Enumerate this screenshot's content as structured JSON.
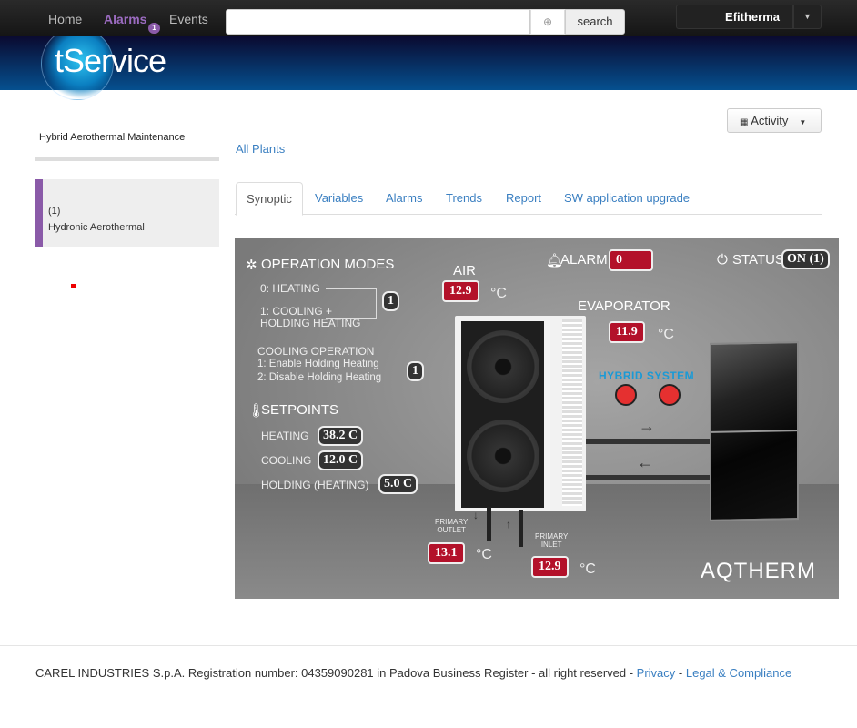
{
  "topnav": {
    "home": "Home",
    "alarms": "Alarms",
    "alarms_badge": "1",
    "events": "Events",
    "search_value": "",
    "search_button": "search",
    "user": "Efitherma"
  },
  "brand": {
    "logo": "tService"
  },
  "sidebar": {
    "plant_name": "Hybrid Aerothermal Maintenance",
    "items": [
      {
        "id": "(1)",
        "label": "Hydronic Aerothermal"
      }
    ]
  },
  "activity_button": "Activity",
  "breadcrumb": "All Plants",
  "tabs": [
    "Synoptic",
    "Variables",
    "Alarms",
    "Trends",
    "Report",
    "SW application upgrade"
  ],
  "active_tab": "Synoptic",
  "synoptic": {
    "operation_modes_title": "OPERATION MODES",
    "mode0": "0: HEATING",
    "mode1a": "1: COOLING +",
    "mode1b": "HOLDING HEATING",
    "mode_value": "1",
    "cooling_title": "COOLING OPERATION",
    "cool1": "1: Enable Holding Heating",
    "cool2": "2: Disable Holding Heating",
    "cooling_value": "1",
    "setpoints_title": "SETPOINTS",
    "heating_label": "HEATING",
    "heating_value": "38.2 C",
    "cooling_label": "COOLING",
    "cooling_sp_value": "12.0 C",
    "holding_label": "HOLDING (HEATING)",
    "holding_value": "5.0 C",
    "alarm_label": "ALARM",
    "alarm_value": "0",
    "status_label": "STATUS",
    "status_value": "ON (1)",
    "air_label": "AIR",
    "air_value": "12.9",
    "evap_label": "EVAPORATOR",
    "evap_value": "11.9",
    "unit": "°C",
    "hybrid_label": "HYBRID SYSTEM",
    "outlet_label1": "PRIMARY",
    "outlet_label2": "OUTLET",
    "outlet_value": "13.1",
    "inlet_label1": "PRIMARY",
    "inlet_label2": "INLET",
    "inlet_value": "12.9",
    "brand_logo": "AQTHERM",
    "led_color": "#e53030",
    "hybrid_color": "#1a9ad6"
  },
  "footer": {
    "text": "CAREL INDUSTRIES S.p.A. Registration number: 04359090281 in Padova Business Register - all right reserved - ",
    "privacy": "Privacy",
    "sep": " - ",
    "legal": "Legal & Compliance"
  }
}
